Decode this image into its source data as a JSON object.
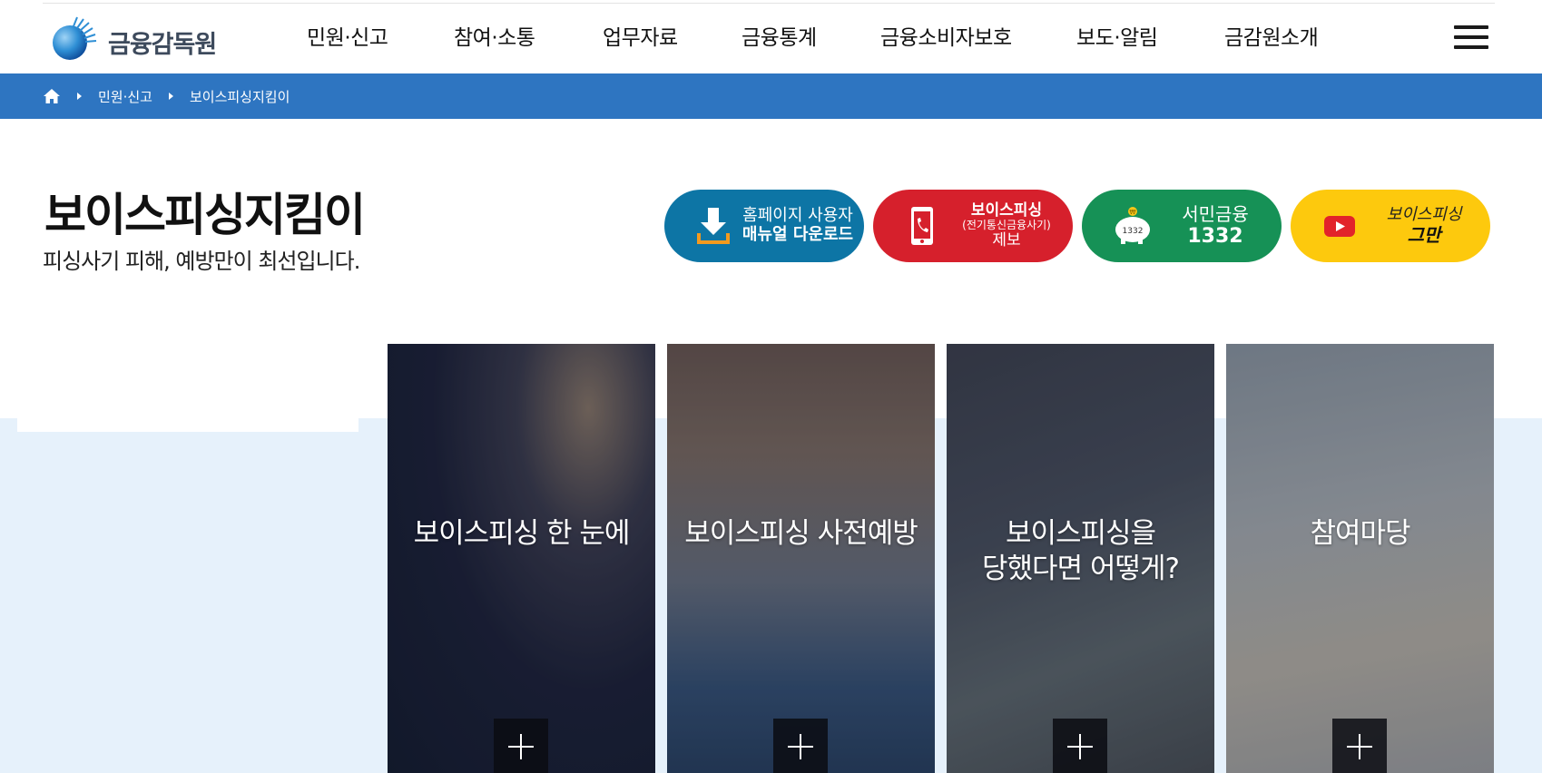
{
  "header": {
    "logo_text": "금융감독원",
    "nav": [
      {
        "label": "민원·신고"
      },
      {
        "label": "참여·소통"
      },
      {
        "label": "업무자료"
      },
      {
        "label": "금융통계"
      },
      {
        "label": "금융소비자보호"
      },
      {
        "label": "보도·알림"
      },
      {
        "label": "금감원소개"
      }
    ]
  },
  "breadcrumb": {
    "items": [
      "민원·신고",
      "보이스피싱지킴이"
    ]
  },
  "page": {
    "title": "보이스피싱지킴이",
    "subtitle": "피싱사기 피해, 예방만이 최선입니다."
  },
  "quick_buttons": {
    "manual": {
      "line1": "홈페이지 사용자",
      "line2": "매뉴얼 다운로드"
    },
    "report": {
      "line1": "보이스피싱",
      "line2": "(전기통신금융사기)",
      "line3": "제보"
    },
    "seomin": {
      "line1": "서민금융",
      "line2": "1332",
      "icon_text": "1332"
    },
    "youtube": {
      "line1": "보이스피싱",
      "line2": "그만"
    }
  },
  "cards": [
    {
      "title": "보이스피싱 한 눈에"
    },
    {
      "title": "보이스피싱 사전예방"
    },
    {
      "title_line1": "보이스피싱을",
      "title_line2": "당했다면 어떻게?"
    },
    {
      "title": "참여마당"
    }
  ],
  "colors": {
    "breadcrumb_bar": "#2e75c1",
    "pill_manual": "#0d75a5",
    "pill_report": "#d6202c",
    "pill_seomin": "#169156",
    "pill_youtube": "#fdc90d",
    "lower_background": "#e6f1fb"
  },
  "icons": [
    "home-icon",
    "menu-icon",
    "download-icon",
    "phone-icon",
    "piggy-bank-icon",
    "youtube-icon",
    "plus-icon"
  ]
}
